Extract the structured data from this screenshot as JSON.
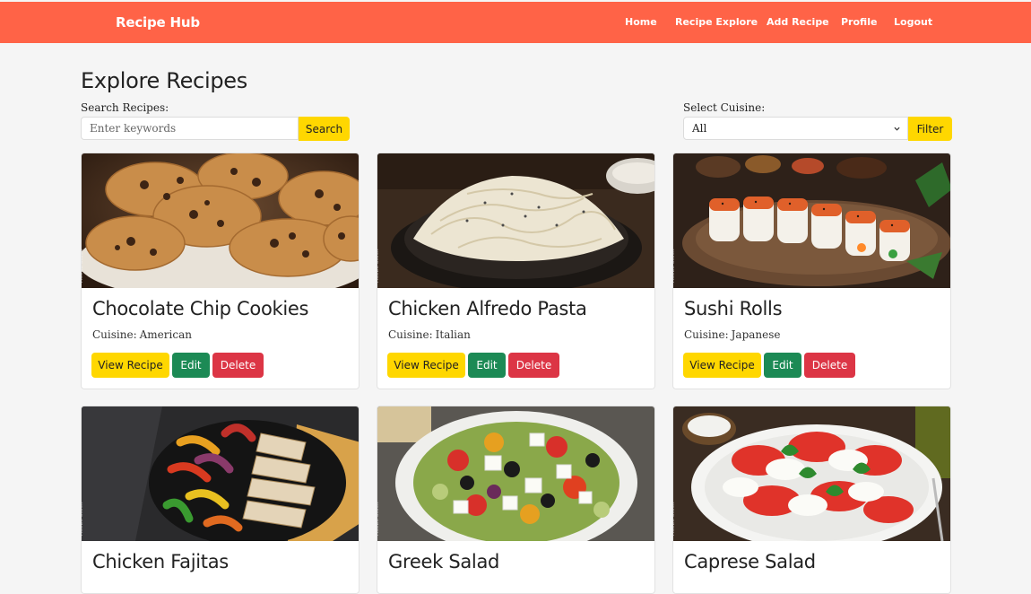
{
  "navbar": {
    "brand": "Recipe Hub",
    "links": [
      "Home",
      "Recipe Explore",
      "Add Recipe",
      "Profile",
      "Logout"
    ]
  },
  "page": {
    "title": "Explore Recipes",
    "search_label": "Search Recipes:",
    "search_placeholder": "Enter keywords",
    "search_button": "Search",
    "cuisine_label": "Select Cuisine:",
    "cuisine_selected": "All",
    "filter_button": "Filter"
  },
  "card_labels": {
    "cuisine_prefix": "Cuisine:",
    "view": "View Recipe",
    "edit": "Edit",
    "delete": "Delete"
  },
  "recipes": [
    {
      "title": "Chocolate Chip Cookies",
      "cuisine": "American",
      "image_icon": "cookies-photo"
    },
    {
      "title": "Chicken Alfredo Pasta",
      "cuisine": "Italian",
      "image_icon": "pasta-photo"
    },
    {
      "title": "Sushi Rolls",
      "cuisine": "Japanese",
      "image_icon": "sushi-photo"
    },
    {
      "title": "Chicken Fajitas",
      "cuisine": "",
      "image_icon": "fajitas-photo"
    },
    {
      "title": "Greek Salad",
      "cuisine": "",
      "image_icon": "greek-salad-photo"
    },
    {
      "title": "Caprese Salad",
      "cuisine": "",
      "image_icon": "caprese-salad-photo"
    }
  ],
  "colors": {
    "navbar": "#ff6347",
    "accent_yellow": "#ffd700",
    "edit_green": "#1c8a55",
    "delete_red": "#dc3545"
  }
}
